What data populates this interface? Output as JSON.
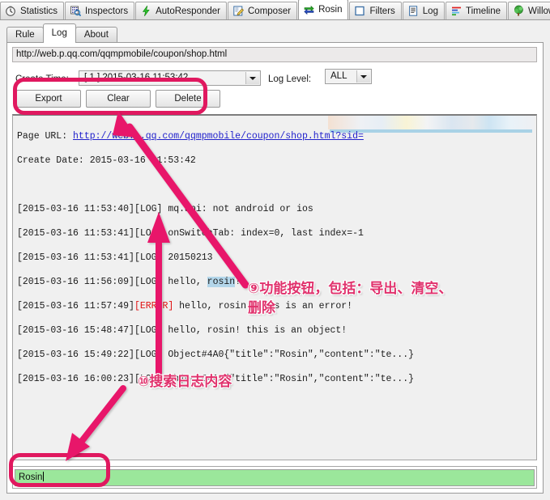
{
  "window": {
    "main_tabs": [
      {
        "label": "Statistics",
        "icon": "clock-icon",
        "active": false
      },
      {
        "label": "Inspectors",
        "icon": "magnifier-grid-icon",
        "active": false
      },
      {
        "label": "AutoResponder",
        "icon": "lightning-bolt-icon",
        "active": false
      },
      {
        "label": "Composer",
        "icon": "pencil-notepad-icon",
        "active": false
      },
      {
        "label": "Rosin",
        "icon": "exchange-arrows-icon",
        "active": true
      },
      {
        "label": "Filters",
        "icon": "empty-square-icon",
        "active": false
      },
      {
        "label": "Log",
        "icon": "document-lines-icon",
        "active": false
      },
      {
        "label": "Timeline",
        "icon": "timeline-bars-icon",
        "active": false
      },
      {
        "label": "Willow",
        "icon": "tree-icon",
        "active": false
      }
    ],
    "sub_tabs": [
      {
        "label": "Rule",
        "active": false
      },
      {
        "label": "Log",
        "active": true
      },
      {
        "label": "About",
        "active": false
      }
    ]
  },
  "toolbar": {
    "url_value": "http://web.p.qq.com/qqmpmobile/coupon/shop.html",
    "create_time_label": "Create Time:",
    "create_time_value": "[ 1 ] 2015-03-16 11:53:42",
    "log_level_label": "Log Level:",
    "log_level_value": "ALL",
    "export_label": "Export",
    "clear_label": "Clear",
    "delete_label": "Delete"
  },
  "log": {
    "page_url_label": "Page URL: ",
    "page_url_value": "http://web.p.qq.com/qqmpmobile/coupon/shop.html?sid=",
    "create_date_line": "Create Date: 2015-03-16 11:53:42",
    "entries": [
      {
        "time": "[2015-03-16 11:53:40]",
        "level": "[LOG]",
        "message": " mq.api: not android or ios"
      },
      {
        "time": "[2015-03-16 11:53:41]",
        "level": "[LOG]",
        "message": " onSwitchTab: index=0, last index=-1"
      },
      {
        "time": "[2015-03-16 11:53:41]",
        "level": "[LOG]",
        "message": " 20150213"
      },
      {
        "time": "[2015-03-16 11:56:09]",
        "level": "[LOG]",
        "message": " hello, ",
        "highlight": "rosin",
        "tail": "!"
      },
      {
        "time": "[2015-03-16 11:57:49]",
        "level": "[ERROR]",
        "message": " hello, rosin! this is an error!"
      },
      {
        "time": "[2015-03-16 15:48:47]",
        "level": "[LOG]",
        "message": " hello, rosin! this is an object!"
      },
      {
        "time": "[2015-03-16 15:49:22]",
        "level": "[LOG]",
        "message": " Object#4A0{\"title\":\"Rosin\",\"content\":\"te...}"
      },
      {
        "time": "[2015-03-16 16:00:23]",
        "level": "[LOG]",
        "message": " ObjectC4A1{\"title\":\"Rosin\",\"content\":\"te...}"
      }
    ]
  },
  "search": {
    "value": "Rosin"
  },
  "annotations": [
    {
      "id": "anno-9",
      "text": "⑨功能按钮，包括：导出、清空、\n删除"
    },
    {
      "id": "anno-10",
      "text": "⑩搜索日志内容"
    }
  ],
  "colors": {
    "annotation_pink": "#e0316c",
    "highlight_rect": "#e0185f",
    "search_field_green": "#9be79b",
    "error_red": "#e01010",
    "link_blue": "#2222cc",
    "selection_blue": "#b3d6ea"
  }
}
